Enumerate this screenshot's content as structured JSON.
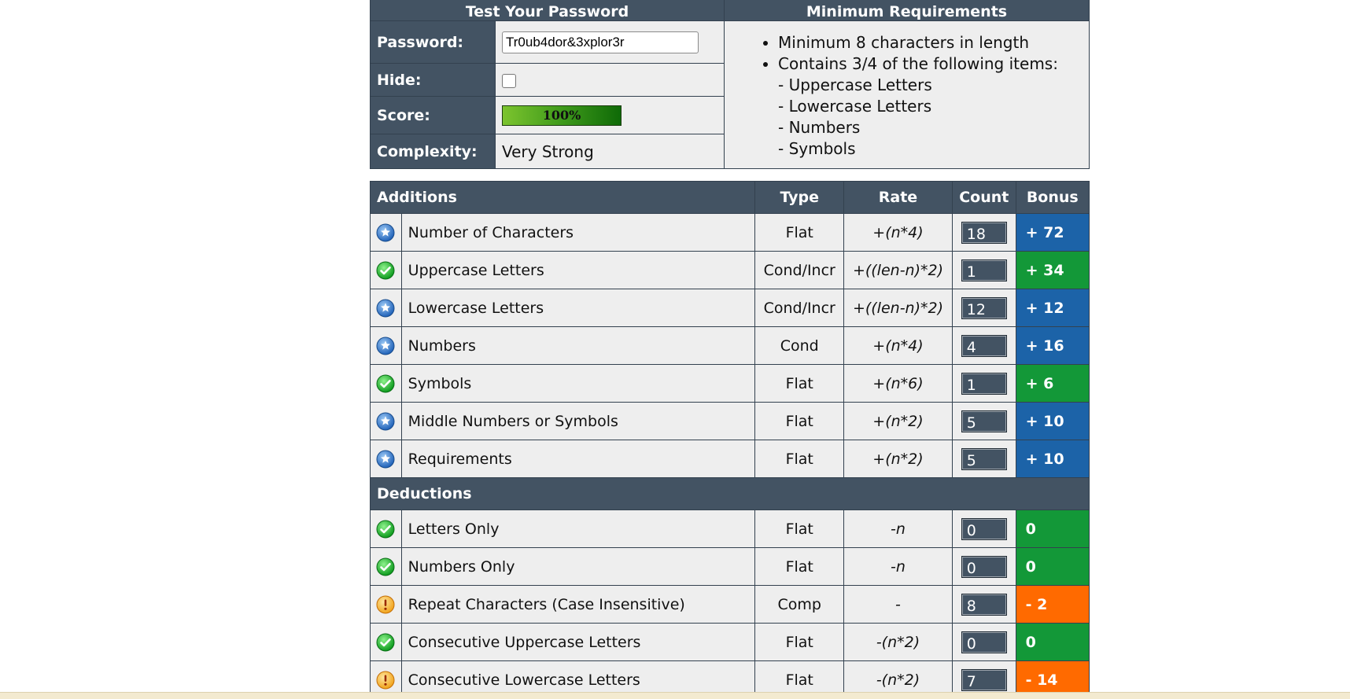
{
  "test": {
    "header": "Test Your Password",
    "password_label": "Password:",
    "password_value": "Tr0ub4dor&3xplor3r",
    "hide_label": "Hide:",
    "score_label": "Score:",
    "score_value": "100%",
    "score_percent": 100,
    "complexity_label": "Complexity:",
    "complexity_value": "Very Strong"
  },
  "requirements": {
    "header": "Minimum Requirements",
    "items": [
      "Minimum 8 characters in length",
      "Contains 3/4 of the following items:"
    ],
    "sub_items": [
      "- Uppercase Letters",
      "- Lowercase Letters",
      "- Numbers",
      "- Symbols"
    ]
  },
  "columns": {
    "additions": "Additions",
    "type": "Type",
    "rate": "Rate",
    "count": "Count",
    "bonus": "Bonus"
  },
  "deductions_label": "Deductions",
  "additions": [
    {
      "status": "exceptional",
      "name": "Number of Characters",
      "type": "Flat",
      "rate": "+(n*4)",
      "count": "18",
      "bonus": "+ 72",
      "bonus_color": "blue"
    },
    {
      "status": "sufficient",
      "name": "Uppercase Letters",
      "type": "Cond/Incr",
      "rate": "+((len-n)*2)",
      "count": "1",
      "bonus": "+ 34",
      "bonus_color": "green"
    },
    {
      "status": "exceptional",
      "name": "Lowercase Letters",
      "type": "Cond/Incr",
      "rate": "+((len-n)*2)",
      "count": "12",
      "bonus": "+ 12",
      "bonus_color": "blue"
    },
    {
      "status": "exceptional",
      "name": "Numbers",
      "type": "Cond",
      "rate": "+(n*4)",
      "count": "4",
      "bonus": "+ 16",
      "bonus_color": "blue"
    },
    {
      "status": "sufficient",
      "name": "Symbols",
      "type": "Flat",
      "rate": "+(n*6)",
      "count": "1",
      "bonus": "+ 6",
      "bonus_color": "green"
    },
    {
      "status": "exceptional",
      "name": "Middle Numbers or Symbols",
      "type": "Flat",
      "rate": "+(n*2)",
      "count": "5",
      "bonus": "+ 10",
      "bonus_color": "blue"
    },
    {
      "status": "exceptional",
      "name": "Requirements",
      "type": "Flat",
      "rate": "+(n*2)",
      "count": "5",
      "bonus": "+ 10",
      "bonus_color": "blue"
    }
  ],
  "deductions": [
    {
      "status": "sufficient",
      "name": "Letters Only",
      "type": "Flat",
      "rate": "-n",
      "count": "0",
      "bonus": "0",
      "bonus_color": "green"
    },
    {
      "status": "sufficient",
      "name": "Numbers Only",
      "type": "Flat",
      "rate": "-n",
      "count": "0",
      "bonus": "0",
      "bonus_color": "green"
    },
    {
      "status": "warning",
      "name": "Repeat Characters (Case Insensitive)",
      "type": "Comp",
      "rate": "-",
      "count": "8",
      "bonus": "- 2",
      "bonus_color": "orange"
    },
    {
      "status": "sufficient",
      "name": "Consecutive Uppercase Letters",
      "type": "Flat",
      "rate": "-(n*2)",
      "count": "0",
      "bonus": "0",
      "bonus_color": "green"
    },
    {
      "status": "warning",
      "name": "Consecutive Lowercase Letters",
      "type": "Flat",
      "rate": "-(n*2)",
      "count": "7",
      "bonus": "- 14",
      "bonus_color": "orange"
    }
  ],
  "colors": {
    "header_bg": "#435363",
    "cell_bg": "#eeeeee",
    "blue": "#1c63a8",
    "green": "#139838",
    "orange": "#ff6a00"
  },
  "icons": {
    "exceptional": "exceptional-star-icon",
    "sufficient": "sufficient-check-icon",
    "warning": "warning-exclamation-icon"
  }
}
